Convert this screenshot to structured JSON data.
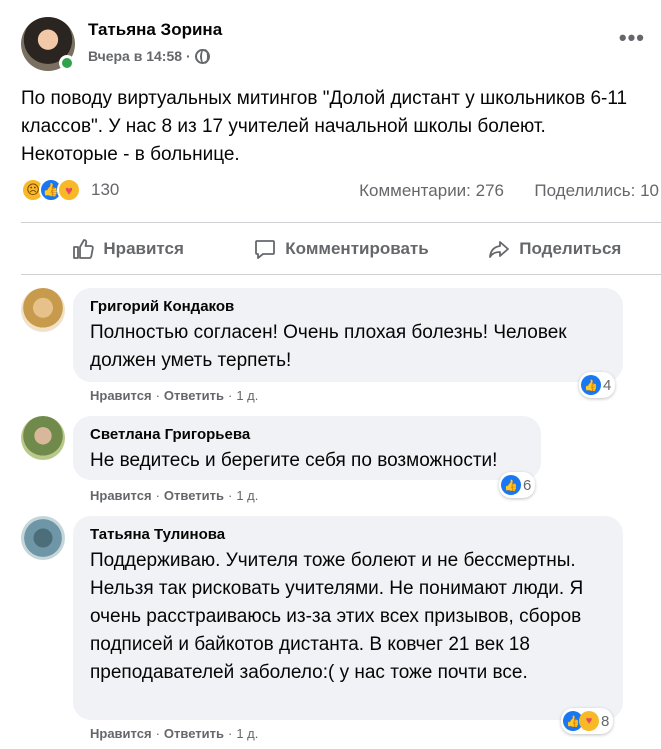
{
  "post": {
    "author": "Татьяна Зорина",
    "time": "Вчера в 14:58",
    "separator": "·",
    "text": "По поводу виртуальных митингов \"Долой дистант у школьников 6-11 классов\". У нас 8 из 17 учителей начальной школы болеют. Некоторые - в больнице.",
    "reaction_count": "130",
    "comments": "Комментарии: 276",
    "shares": "Поделились: 10",
    "reaction_icons": [
      "sad-icon",
      "like-icon",
      "care-icon"
    ]
  },
  "actions": {
    "like": "Нравится",
    "comment": "Комментировать",
    "share": "Поделиться"
  },
  "comments": [
    {
      "name": "Григорий Кондаков",
      "text": "Полностью согласен! Очень плохая болезнь! Человек должен уметь терпеть!",
      "like_count": "4",
      "like": "Нравится",
      "reply": "Ответить",
      "age": "1 д."
    },
    {
      "name": "Светлана Григорьева",
      "text": "Не ведитесь и берегите себя по возможности!",
      "like_count": "6",
      "like": "Нравится",
      "reply": "Ответить",
      "age": "1 д."
    },
    {
      "name": "Татьяна Тулинова",
      "text": "Поддерживаю. Учителя тоже болеют и не бессмертны. Нельзя так рисковать учителями. Не понимают люди. Я очень расстраиваюсь из-за этих всех призывов, сборов подписей и байкотов дистанта. В ковчег 21 век 18 преподавателей заболело:( у нас тоже почти все.",
      "like_count": "8",
      "like": "Нравится",
      "reply": "Ответить",
      "age": "1 д."
    }
  ],
  "dot": "·",
  "colors": {
    "accent": "#1877f2",
    "secondary_text": "#65676b",
    "bubble": "#f0f2f5",
    "online": "#31a24c"
  }
}
